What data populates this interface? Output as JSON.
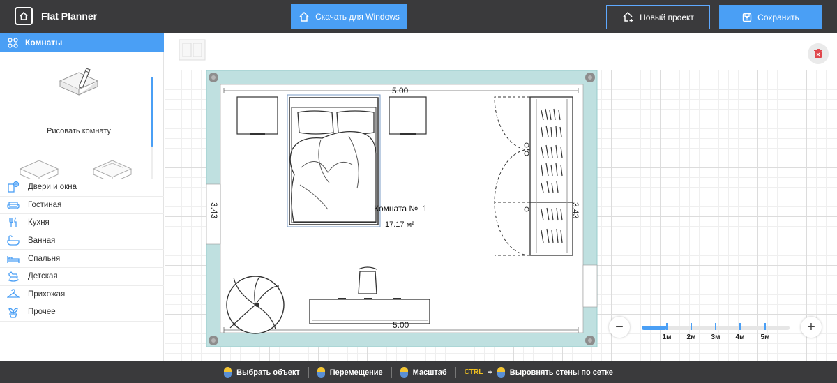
{
  "app": {
    "title": "Flat Planner"
  },
  "topbar": {
    "download_label": "Скачать для Windows",
    "new_project_label": "Новый проект",
    "save_label": "Сохранить"
  },
  "sidebar": {
    "rooms_header": "Комнаты",
    "draw_room_label": "Рисовать комнату",
    "categories": [
      {
        "label": "Двери и окна",
        "icon": "door-window-icon"
      },
      {
        "label": "Гостиная",
        "icon": "sofa-icon"
      },
      {
        "label": "Кухня",
        "icon": "cutlery-icon"
      },
      {
        "label": "Ванная",
        "icon": "bathtub-icon"
      },
      {
        "label": "Спальня",
        "icon": "bed-icon"
      },
      {
        "label": "Детская",
        "icon": "rocking-horse-icon"
      },
      {
        "label": "Прихожая",
        "icon": "hanger-icon"
      },
      {
        "label": "Прочее",
        "icon": "plant-icon"
      }
    ]
  },
  "plan": {
    "room_name": "Комната №  1",
    "room_area": "17.17 м²",
    "dim_top": "5.00",
    "dim_bottom": "5.00",
    "dim_left": "3.43",
    "dim_right": "3.43"
  },
  "zoom": {
    "labels": [
      "1м",
      "2м",
      "3м",
      "4м",
      "5м"
    ],
    "level": 0.17
  },
  "bottombar": {
    "select_hint": "Выбрать объект",
    "move_hint": "Перемещение",
    "scale_hint": "Масштаб",
    "ctrl_key": "CTRL",
    "plus": "+",
    "align_hint": "Выровнять стены по сетке"
  },
  "colors": {
    "accent": "#4a9ff5",
    "topbar": "#3a3a3c",
    "wall": "#bfe0e0"
  }
}
